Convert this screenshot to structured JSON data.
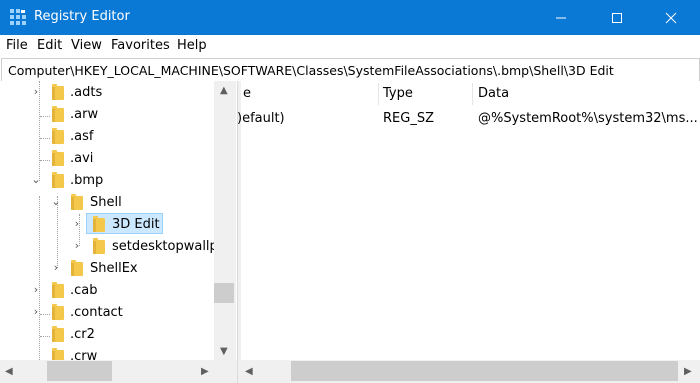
{
  "window": {
    "title": "Registry Editor",
    "accent": "#0a79d6",
    "controls": {
      "minimize": "minimize-icon",
      "maximize": "maximize-icon",
      "close": "close-icon"
    }
  },
  "menu": [
    "File",
    "Edit",
    "View",
    "Favorites",
    "Help"
  ],
  "address": "Computer\\HKEY_LOCAL_MACHINE\\SOFTWARE\\Classes\\SystemFileAssociations\\.bmp\\Shell\\3D Edit",
  "tree": {
    "items": [
      {
        "label": ".adts",
        "expanded": false
      },
      {
        "label": ".arw"
      },
      {
        "label": ".asf"
      },
      {
        "label": ".avi"
      },
      {
        "label": ".bmp",
        "expanded": true
      },
      {
        "label": "Shell",
        "expanded": true
      },
      {
        "label": "3D Edit",
        "selected": true
      },
      {
        "label": "setdesktopwallp"
      },
      {
        "label": "ShellEx"
      },
      {
        "label": ".cab"
      },
      {
        "label": ".contact"
      },
      {
        "label": ".cr2"
      },
      {
        "label": ".crw"
      }
    ]
  },
  "values": {
    "columns": [
      "e",
      "Type",
      "Data"
    ],
    "rows": [
      {
        "name": ")efault)",
        "type": "REG_SZ",
        "data": "@%SystemRoot%\\system32\\ms..."
      }
    ]
  }
}
